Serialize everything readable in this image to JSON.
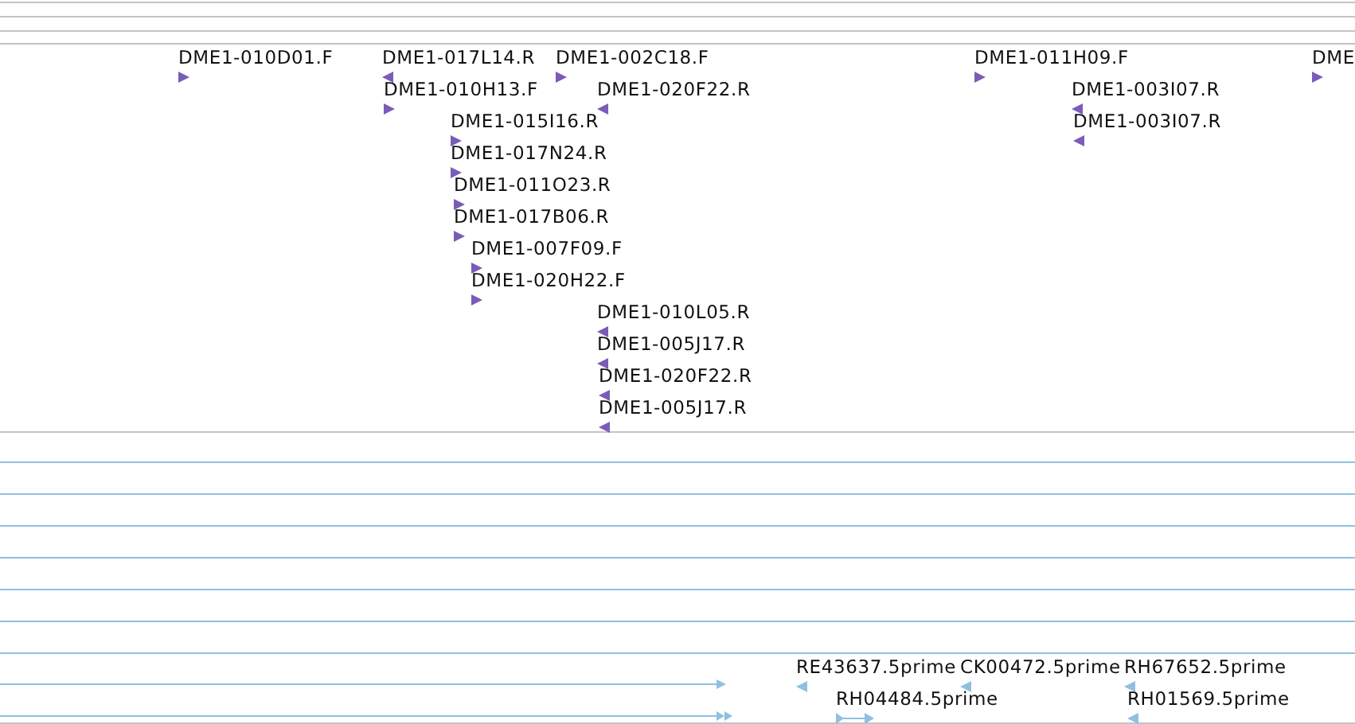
{
  "clone_track": {
    "features": [
      {
        "label": "DME1-010D01.F",
        "kind": "forward"
      },
      {
        "label": "DME1-017L14.R",
        "kind": "reverse"
      },
      {
        "label": "DME1-002C18.F",
        "kind": "forward"
      },
      {
        "label": "DME1-011H09.F",
        "kind": "forward"
      },
      {
        "label": "DME",
        "kind": "forward"
      },
      {
        "label": "DME1-010H13.F",
        "kind": "forward"
      },
      {
        "label": "DME1-020F22.R",
        "kind": "reverse"
      },
      {
        "label": "DME1-003I07.R",
        "kind": "reverse"
      },
      {
        "label": "DME1-015I16.R",
        "kind": "forward"
      },
      {
        "label": "DME1-003I07.R",
        "kind": "reverse"
      },
      {
        "label": "DME1-017N24.R",
        "kind": "forward"
      },
      {
        "label": "DME1-011O23.R",
        "kind": "forward"
      },
      {
        "label": "DME1-017B06.R",
        "kind": "forward"
      },
      {
        "label": "DME1-007F09.F",
        "kind": "forward"
      },
      {
        "label": "DME1-020H22.F",
        "kind": "forward"
      },
      {
        "label": "DME1-010L05.R",
        "kind": "reverse"
      },
      {
        "label": "DME1-005J17.R",
        "kind": "reverse"
      },
      {
        "label": "DME1-020F22.R",
        "kind": "reverse"
      },
      {
        "label": "DME1-005J17.R",
        "kind": "reverse"
      }
    ]
  },
  "est_track": {
    "features": [
      {
        "label": "RE43637.5prime",
        "kind": "reverse"
      },
      {
        "label": "CK00472.5prime",
        "kind": "reverse"
      },
      {
        "label": "RH67652.5prime",
        "kind": "reverse"
      },
      {
        "label": "RH04484.5prime",
        "kind": "forward_span"
      },
      {
        "label": "RH01569.5prime",
        "kind": "reverse"
      }
    ]
  }
}
